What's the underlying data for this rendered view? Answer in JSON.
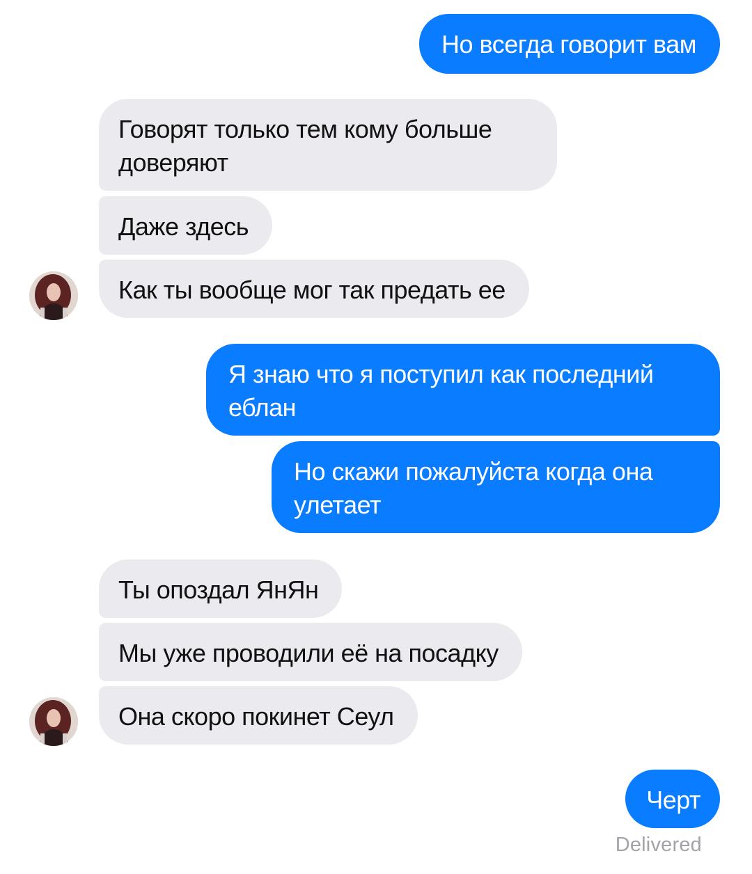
{
  "conversation": {
    "messages": [
      {
        "direction": "outgoing",
        "text": "Но всегда говорит вам"
      },
      {
        "direction": "incoming",
        "text": "Говорят только тем кому больше доверяют"
      },
      {
        "direction": "incoming",
        "text": "Даже здесь"
      },
      {
        "direction": "incoming",
        "text": "Как ты вообще мог так предать ее"
      },
      {
        "direction": "outgoing",
        "text": "Я знаю что я поступил как последний еблан"
      },
      {
        "direction": "outgoing",
        "text": "Но скажи пожалуйста когда она улетает"
      },
      {
        "direction": "incoming",
        "text": "Ты опоздал ЯнЯн"
      },
      {
        "direction": "incoming",
        "text": "Мы уже проводили её на посадку"
      },
      {
        "direction": "incoming",
        "text": "Она скоро покинет Сеул"
      },
      {
        "direction": "outgoing",
        "text": "Черт"
      }
    ],
    "status": "Delivered"
  },
  "colors": {
    "outgoing_bubble": "#0a7cff",
    "incoming_bubble": "#ebeaef",
    "status_text": "#a2a2a8"
  },
  "icons": {
    "contact_avatar": "contact-avatar-photo"
  }
}
